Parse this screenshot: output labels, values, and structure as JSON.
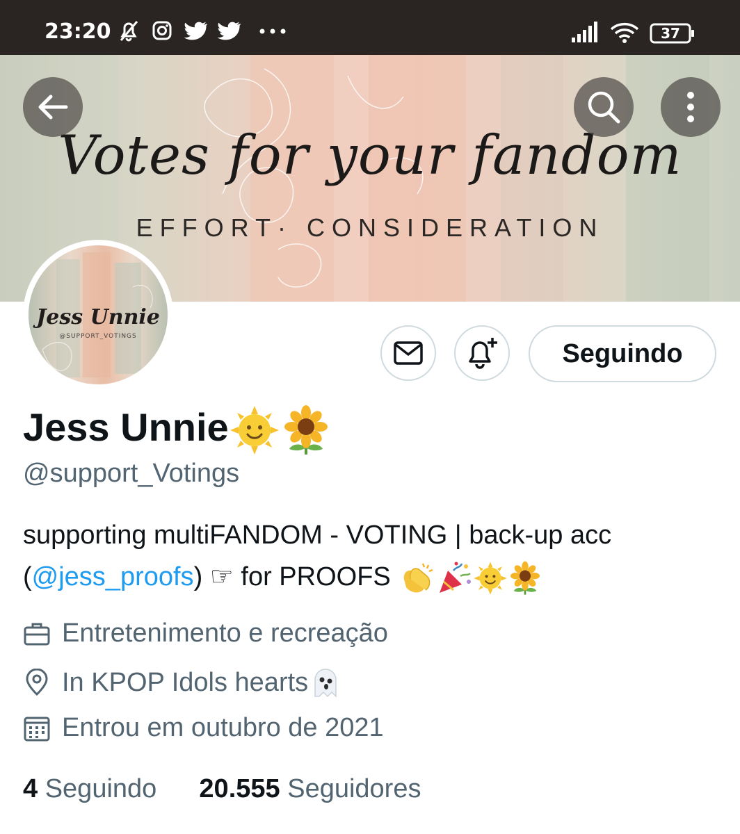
{
  "status_bar": {
    "time": "23:20",
    "battery": "37",
    "icons": [
      "bell-off-icon",
      "instagram-icon",
      "twitter-icon",
      "twitter-icon",
      "more-dots-icon",
      "signal-icon",
      "wifi-icon",
      "battery-icon"
    ]
  },
  "banner": {
    "title": "Votes for your fandom",
    "subtitle": "EFFORT· CONSIDERATION"
  },
  "avatar": {
    "name": "Jess Unnie",
    "handle": "@SUPPORT_VOTINGS"
  },
  "actions": {
    "follow_label": "Seguindo"
  },
  "profile": {
    "display_name": "Jess Unnie",
    "handle": "@support_Votings",
    "bio_line1": "supporting multiFANDOM - VOTING | back-up acc",
    "bio_open": "(",
    "bio_link": "@jess_proofs",
    "bio_after_link": ") ☞ for PROOFS",
    "category": "Entretenimento e recreação",
    "location": "In KPOP Idols hearts",
    "joined": "Entrou em outubro de 2021"
  },
  "stats": {
    "following_count": "4",
    "following_label": "Seguindo",
    "followers_count": "20.555",
    "followers_label": "Seguidores"
  },
  "colors": {
    "link": "#1d9bf0",
    "muted": "#536471",
    "text": "#0f1419",
    "border": "#cfd9de"
  }
}
